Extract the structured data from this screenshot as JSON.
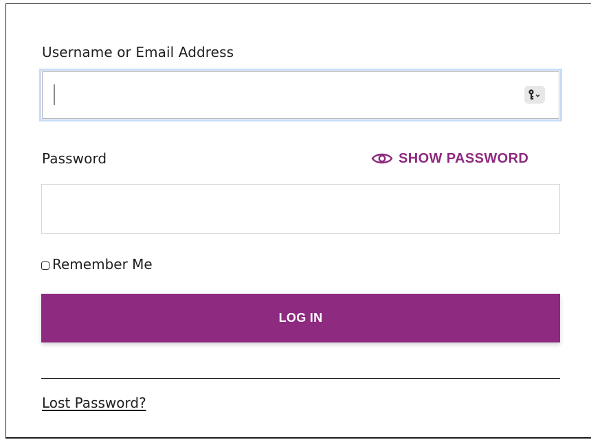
{
  "form": {
    "username": {
      "label": "Username or Email Address",
      "value": "",
      "placeholder": ""
    },
    "password": {
      "label": "Password",
      "value": "",
      "placeholder": "",
      "show_password_label": "SHOW PASSWORD"
    },
    "remember_me_label": "Remember Me",
    "remember_me_checked": false,
    "login_button_label": "LOG IN",
    "lost_password_label": "Lost Password?"
  },
  "icons": {
    "password_manager": "key-icon",
    "show_password": "eye-icon"
  },
  "colors": {
    "accent": "#8e2a7f",
    "focus_ring": "#c9dcf6",
    "text": "#1e1e1e"
  }
}
